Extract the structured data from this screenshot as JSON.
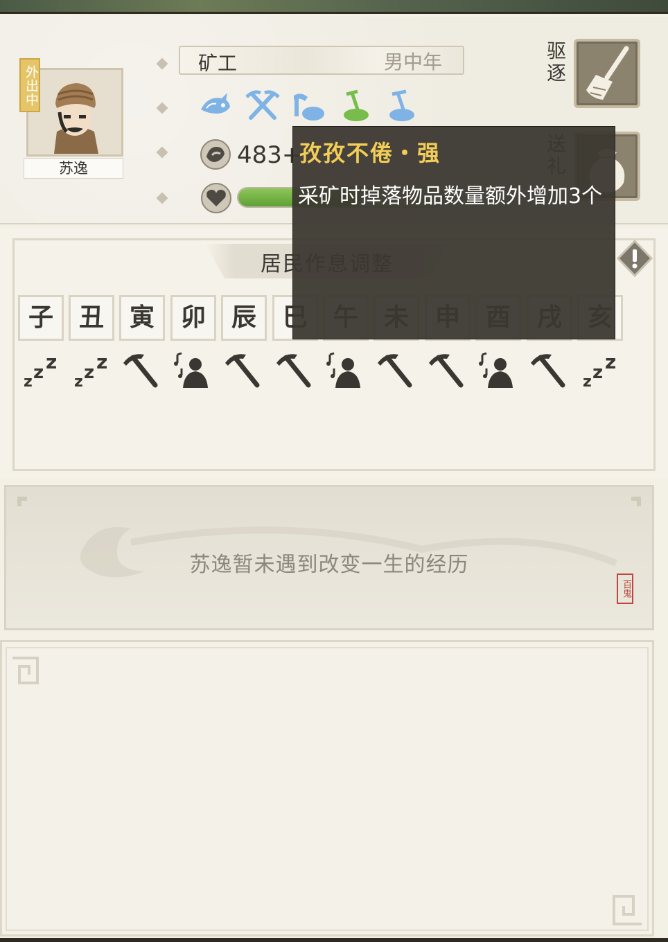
{
  "resident": {
    "name": "苏逸",
    "status_tag": "外出中",
    "job": "矿工",
    "gender_age": "男中年",
    "coins": "483+",
    "health_fraction": 0.6
  },
  "skills": [
    {
      "icon": "fish-skill-icon",
      "color": "#7fb3e6"
    },
    {
      "icon": "crossed-pickaxes-icon",
      "color": "#7fb3e6"
    },
    {
      "icon": "axe-rock-icon",
      "color": "#7fb3e6"
    },
    {
      "icon": "shovel-green-icon",
      "color": "#78bd4c"
    },
    {
      "icon": "shovel-blue-icon",
      "color": "#7fb3e6"
    }
  ],
  "actions": {
    "expel_label": "驱逐",
    "gift_label": "送礼"
  },
  "schedule": {
    "title": "居民作息调整",
    "hours": [
      "子",
      "丑",
      "寅",
      "卯",
      "辰",
      "巳",
      "午",
      "未",
      "申",
      "酉",
      "戌",
      "亥"
    ],
    "activities": [
      "sleep",
      "sleep",
      "work",
      "rest",
      "work",
      "work",
      "rest",
      "work",
      "work",
      "rest",
      "work",
      "sleep"
    ]
  },
  "tooltip": {
    "title": "孜孜不倦・强",
    "description": "采矿时掉落物品数量额外增加3个"
  },
  "story": {
    "text": "苏逸暂未遇到改变一生的经历",
    "seal": "百鬼"
  },
  "colors": {
    "accent_gold": "#f2cd58",
    "health_green": "#6aab3c",
    "panel_bg": "#f3f0e6"
  }
}
